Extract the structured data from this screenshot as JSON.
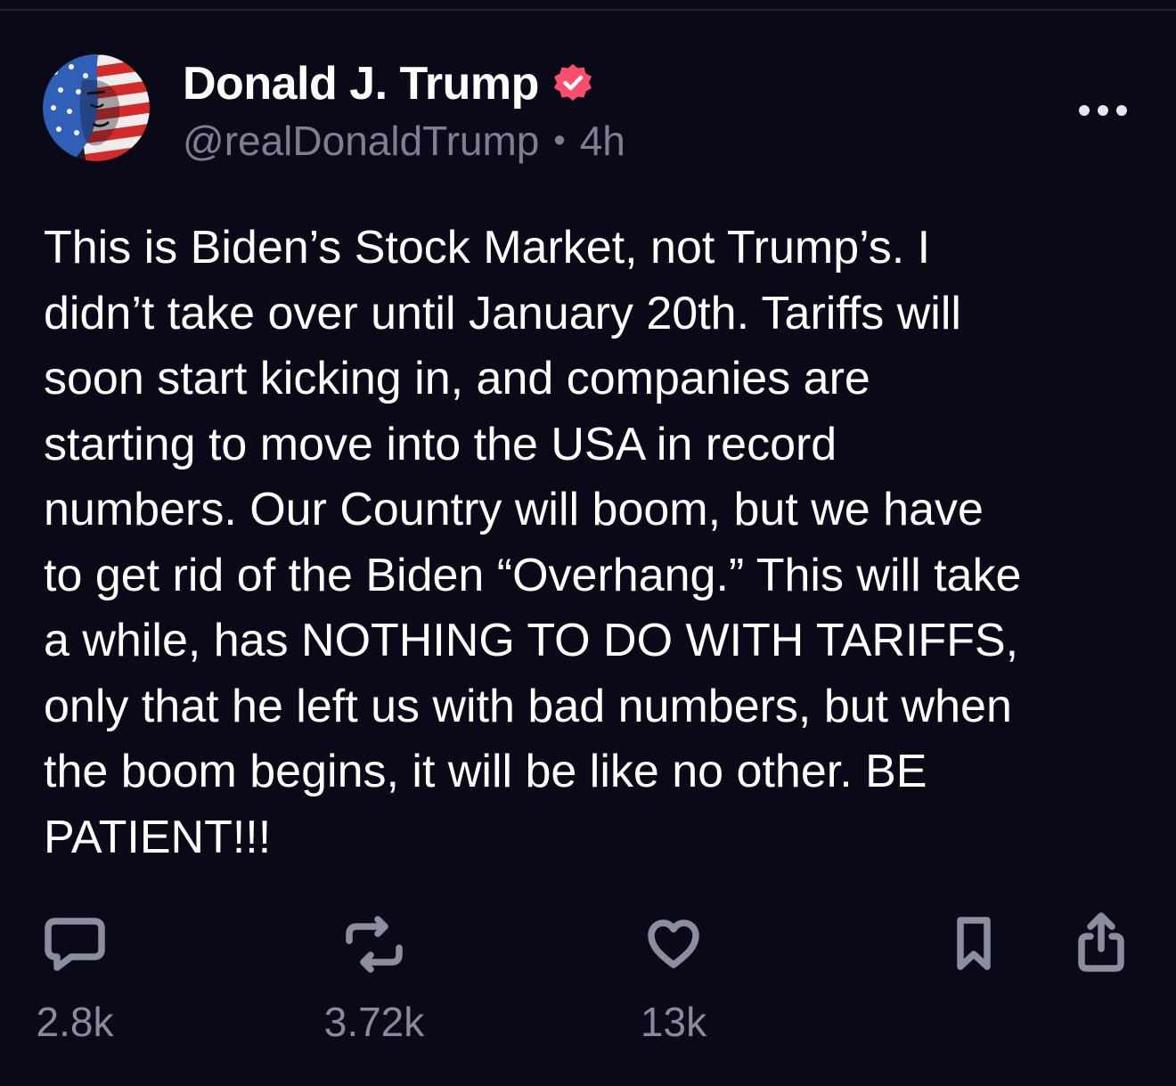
{
  "author": {
    "display_name": "Donald J. Trump",
    "handle": "@realDonaldTrump",
    "separator": "•",
    "timestamp": "4h",
    "verified": true,
    "verified_color": "#ff4d6d",
    "avatar_icon": "flag-face-avatar"
  },
  "post": {
    "text": "This is Biden’s Stock Market, not Trump’s. I\ndidn’t take over until January 20th. Tariffs will\nsoon start kicking in, and companies are\nstarting to move into the USA in record\nnumbers. Our Country will boom, but we have\nto get rid of the Biden “Overhang.” This will take\na while, has NOTHING TO DO WITH TARIFFS,\nonly that he left us with bad numbers, but when\nthe boom begins, it will be like no other. BE\nPATIENT!!!"
  },
  "actions": {
    "reply": {
      "icon": "comment-icon",
      "count": "2.8k"
    },
    "repost": {
      "icon": "repost-icon",
      "count": "3.72k"
    },
    "like": {
      "icon": "heart-icon",
      "count": "13k"
    },
    "bookmark": {
      "icon": "bookmark-icon"
    },
    "share": {
      "icon": "share-icon"
    }
  },
  "colors": {
    "background": "#0a0918",
    "text": "#ffffff",
    "muted": "#7f7e92",
    "icon": "#8d8da0"
  }
}
